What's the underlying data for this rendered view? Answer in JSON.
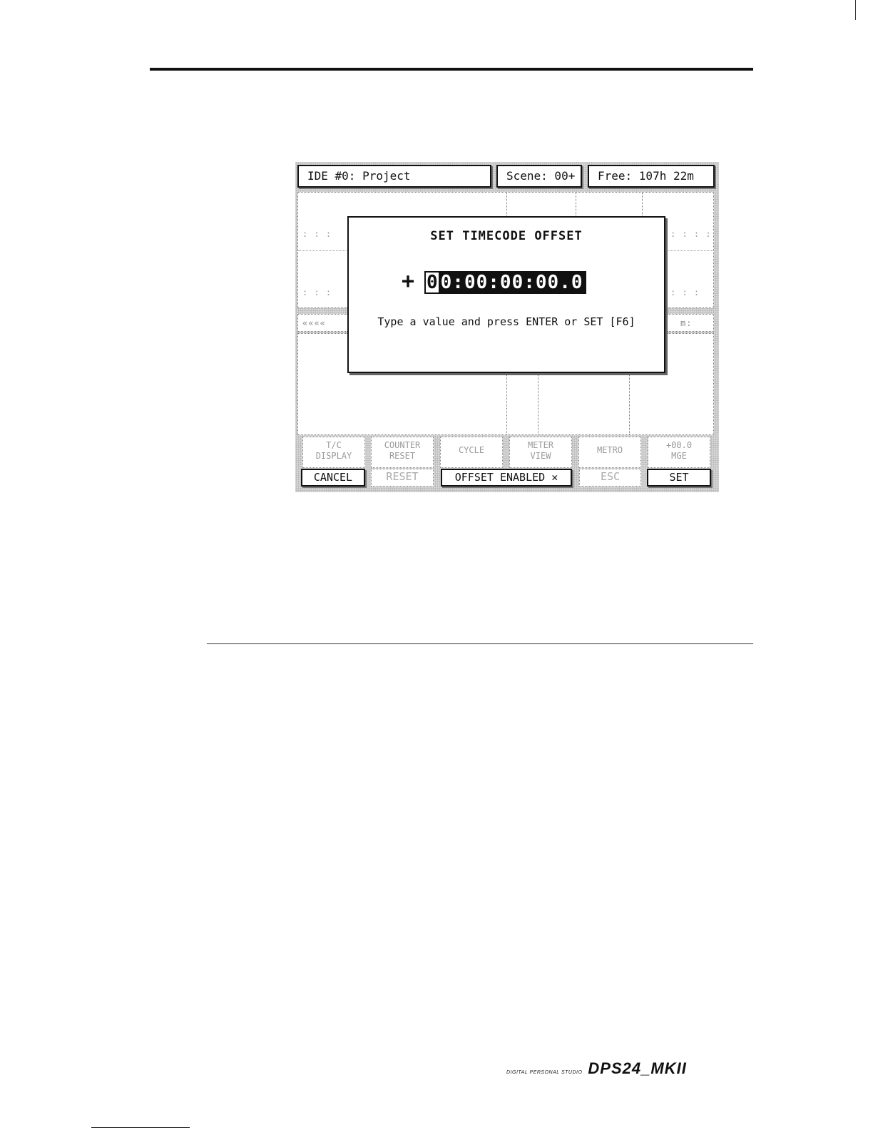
{
  "header": {
    "project": "IDE #0: Project",
    "scene": "Scene: 00+",
    "free": "Free: 107h 22m"
  },
  "background": {
    "row1_left_glyphs": ": : :",
    "row1_right_glyphs": ": : : :",
    "row2_left_glyphs": ": : :",
    "row2_right_glyphs": ": : :",
    "status_left": "««««",
    "status_right": "m:"
  },
  "dialog": {
    "title": "SET TIMECODE OFFSET",
    "sign": "+",
    "cursor_digit": "0",
    "timecode_rest": "0:00:00:00.0",
    "hint": "Type a value and press ENTER or SET [F6]"
  },
  "function_keys": [
    {
      "line1": "T/C",
      "line2": "DISPLAY"
    },
    {
      "line1": "COUNTER",
      "line2": "RESET"
    },
    {
      "line1": "CYCLE",
      "line2": ""
    },
    {
      "line1": "METER",
      "line2": "VIEW"
    },
    {
      "line1": "METRO",
      "line2": ""
    },
    {
      "line1": "+00.0",
      "line2": "MGE"
    }
  ],
  "softkeys": {
    "cancel": "CANCEL",
    "reset": "RESET",
    "offset_enabled": "OFFSET ENABLED ✕",
    "esc": "ESC",
    "set": "SET"
  },
  "footer": {
    "brand_small": "DIGITAL PERSONAL STUDIO",
    "brand_big": "DPS24_MKII"
  }
}
